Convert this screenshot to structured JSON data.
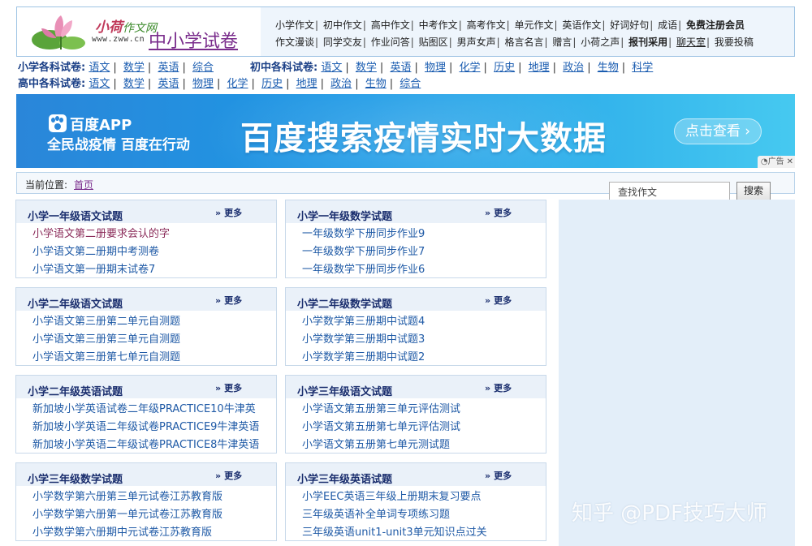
{
  "header": {
    "logo_cn_a": "小荷",
    "logo_cn_b": "作文网",
    "logo_url": "www.zww.cn",
    "site_section": "中小学试卷",
    "topnav_row1": [
      "小学作文",
      "初中作文",
      "高中作文",
      "中考作文",
      "高考作文",
      "单元作文",
      "英语作文",
      "好词好句",
      "成语"
    ],
    "topnav_row1_bold": "免费注册会员",
    "topnav_row2": [
      "作文漫谈",
      "同学交友",
      "作业问答",
      "贴图区",
      "男声女声",
      "格言名言",
      "赠言",
      "小荷之声"
    ],
    "topnav_row2_bold": "报刊采用",
    "topnav_row2_chat": "聊天室",
    "topnav_row2_last": "我要投稿"
  },
  "catnav": {
    "primary_label": "小学各科试卷:",
    "primary_links": [
      "语文",
      "数学",
      "英语",
      "综合"
    ],
    "middle_label": "初中各科试卷:",
    "middle_links": [
      "语文",
      "数学",
      "英语",
      "物理",
      "化学",
      "历史",
      "地理",
      "政治",
      "生物",
      "科学"
    ],
    "high_label": "高中各科试卷:",
    "high_links": [
      "语文",
      "数学",
      "英语",
      "物理",
      "化学",
      "历史",
      "地理",
      "政治",
      "生物",
      "综合"
    ]
  },
  "banner": {
    "app_name": "百度APP",
    "slogan": "全民战疫情 百度在行动",
    "headline": "百度搜索疫情实时大数据",
    "cta": "点击查看",
    "ad_label": "广告",
    "colors": {
      "from": "#2a86d9",
      "to": "#46c9f0"
    }
  },
  "breadcrumb": {
    "label": "当前位置:",
    "home": "首页"
  },
  "search": {
    "placeholder": "查找作文",
    "button": "搜索"
  },
  "more_label": "更多",
  "boxes": [
    {
      "title": "小学一年级语文试题",
      "items": [
        "小学语文第二册要求会认的字",
        "小学语文第二册期中考测卷",
        "小学语文第一册期末试卷7"
      ]
    },
    {
      "title": "小学一年级数学试题",
      "items": [
        "一年级数学下册同步作业9",
        "一年级数学下册同步作业7",
        "一年级数学下册同步作业6"
      ]
    },
    {
      "title": "小学二年级语文试题",
      "items": [
        "小学语文第三册第二单元自测题",
        "小学语文第三册第三单元自测题",
        "小学语文第三册第七单元自测题"
      ]
    },
    {
      "title": "小学二年级数学试题",
      "items": [
        "小学数学第三册期中试题4",
        "小学数学第三册期中试题3",
        "小学数学第三册期中试题2"
      ]
    },
    {
      "title": "小学二年级英语试题",
      "items": [
        "新加坡小学英语试卷二年级PRACTICE10牛津英",
        "新加坡小学英语二年级试卷PRACTICE9牛津英语",
        "新加坡小学英语二年级试卷PRACTICE8牛津英语"
      ]
    },
    {
      "title": "小学三年级语文试题",
      "items": [
        "小学语文第五册第三单元评估测试",
        "小学语文第五册第七单元评估测试",
        "小学语文第五册第七单元测试题"
      ]
    },
    {
      "title": "小学三年级数学试题",
      "items": [
        "小学数学第六册第三单元试卷江苏教育版",
        "小学数学第六册第一单元试卷江苏教育版",
        "小学数学第六册期中元试卷江苏教育版"
      ]
    },
    {
      "title": "小学三年级英语试题",
      "items": [
        "小学EEC英语三年级上册期末复习要点",
        "三年级英语补全单词专项练习题",
        "三年级英语unit1-unit3单元知识点过关"
      ]
    }
  ],
  "watermark": "知乎 @PDF技巧大师"
}
